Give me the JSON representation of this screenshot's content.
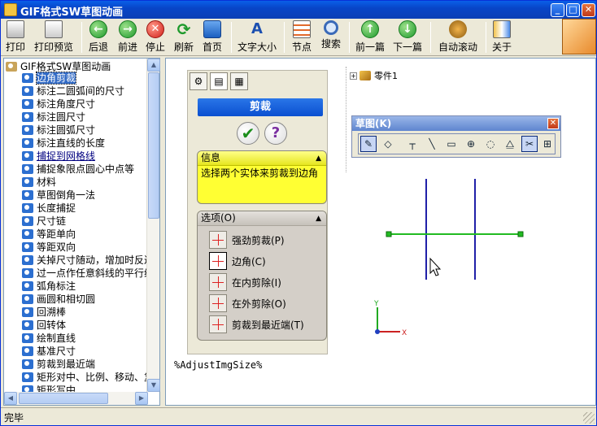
{
  "window": {
    "title": "GIF格式SW草图动画"
  },
  "toolbar": {
    "items": [
      {
        "label": "打印",
        "icon": "printer-icon"
      },
      {
        "label": "打印预览",
        "icon": "print-preview-icon"
      },
      {
        "label": "后退",
        "icon": "back-arrow-icon"
      },
      {
        "label": "前进",
        "icon": "forward-arrow-icon"
      },
      {
        "label": "停止",
        "icon": "stop-icon"
      },
      {
        "label": "刷新",
        "icon": "refresh-icon"
      },
      {
        "label": "首页",
        "icon": "home-icon"
      },
      {
        "label": "文字大小",
        "icon": "font-size-icon"
      },
      {
        "label": "节点",
        "icon": "node-icon"
      },
      {
        "label": "搜索",
        "icon": "search-icon"
      },
      {
        "label": "前一篇",
        "icon": "previous-article-icon"
      },
      {
        "label": "下一篇",
        "icon": "next-article-icon"
      },
      {
        "label": "自动滚动",
        "icon": "auto-scroll-icon"
      },
      {
        "label": "关于",
        "icon": "about-icon"
      }
    ]
  },
  "tree": {
    "root": "GIF格式SW草图动画",
    "items": [
      "边角剪裁",
      "标注二圆弧间的尺寸",
      "标注角度尺寸",
      "标注圆尺寸",
      "标注圆弧尺寸",
      "标注直线的长度",
      "捕捉到网格线",
      "捕捉象限点圆心中点等",
      "材料",
      "草图倒角一法",
      "长度捕捉",
      "尺寸链",
      "等距单向",
      "等距双向",
      "关掉尺寸随动，增加时反过",
      "过一点作任意斜线的平行线",
      "弧角标注",
      "画圆和相切圆",
      "回溯棒",
      "回转体",
      "绘制直线",
      "基准尺寸",
      "剪裁到最近端",
      "矩形对中、比例、移动、复制",
      "矩形写中"
    ],
    "selected_index": 0,
    "link_index": 6
  },
  "feature_manager": {
    "title": "剪裁",
    "info_header": "信息",
    "info_text": "选择两个实体来剪裁到边角",
    "options_header": "选项(O)",
    "options": [
      {
        "label": "强劲剪裁(P)",
        "selected": false
      },
      {
        "label": "边角(C)",
        "selected": true
      },
      {
        "label": "在内剪除(I)",
        "selected": false
      },
      {
        "label": "在外剪除(O)",
        "selected": false
      },
      {
        "label": "剪裁到最近端(T)",
        "selected": false
      }
    ]
  },
  "model_tree": {
    "part_label": "零件1"
  },
  "sketch_toolbar": {
    "title": "草图(K)",
    "tools": [
      "sketch-icon",
      "smart-dimension-icon",
      "line-tool-icon",
      "line-icon",
      "rectangle-icon",
      "circle-icon",
      "arc-icon",
      "mirror-icon",
      "trim-icon",
      "relations-icon"
    ]
  },
  "canvas": {
    "axis_y": "Y",
    "axis_x": "X"
  },
  "body_text": "%AdjustImgSize%",
  "status": {
    "text": "完毕"
  },
  "colors": {
    "title_bar": "#0a4fd0",
    "selection": "#316ac5",
    "info_bg": "#ffff33",
    "sketch_line": "#2020a8",
    "construction_line": "#22bb22"
  }
}
